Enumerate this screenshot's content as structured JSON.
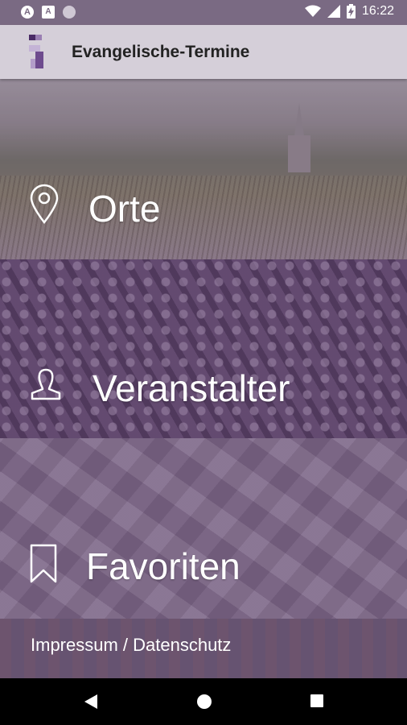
{
  "status_bar": {
    "time": "16:22",
    "left_icons": [
      "a-notification-icon",
      "a-box-notification-icon",
      "circle-notification-icon"
    ],
    "right_icons": [
      "wifi-icon",
      "signal-icon",
      "battery-charging-icon"
    ]
  },
  "app_bar": {
    "title": "Evangelische-Termine",
    "logo_icon": "app-logo-icon"
  },
  "menu": {
    "items": [
      {
        "label": "Orte",
        "icon": "location-pin-icon"
      },
      {
        "label": "Veranstalter",
        "icon": "person-icon"
      },
      {
        "label": "Favoriten",
        "icon": "bookmark-icon"
      }
    ],
    "footer_link": "Impressum / Datenschutz"
  },
  "nav_bar": {
    "buttons": [
      "back-icon",
      "home-icon",
      "recents-icon"
    ]
  },
  "colors": {
    "status_bar": "#7a6a83",
    "app_bar": "#d5cfd9",
    "brand_purple": "#6e4b8e"
  }
}
